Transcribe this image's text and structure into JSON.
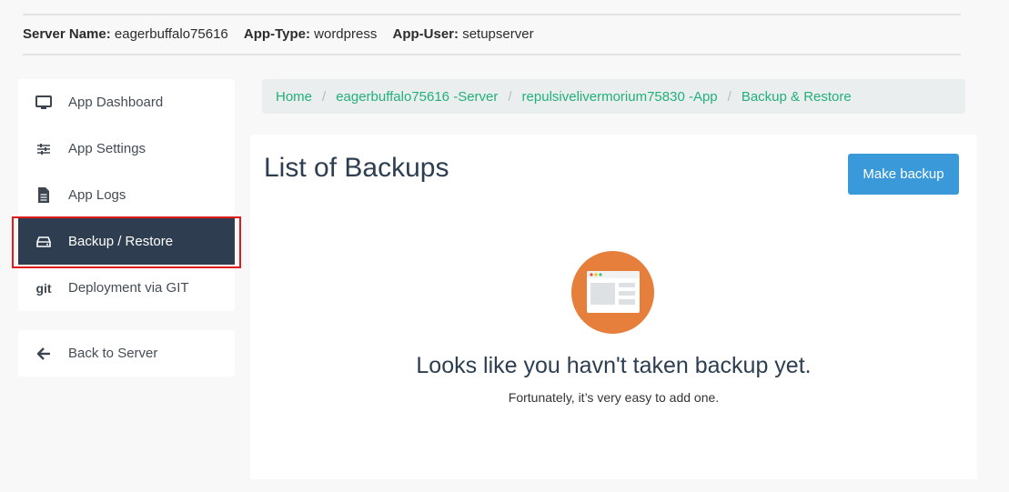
{
  "header": {
    "server_name_label": "Server Name:",
    "server_name_value": "eagerbuffalo75616",
    "app_type_label": "App-Type:",
    "app_type_value": "wordpress",
    "app_user_label": "App-User:",
    "app_user_value": "setupserver"
  },
  "sidebar": {
    "items": [
      {
        "label": "App Dashboard",
        "icon": "monitor-icon"
      },
      {
        "label": "App Settings",
        "icon": "sliders-icon"
      },
      {
        "label": "App Logs",
        "icon": "file-icon"
      },
      {
        "label": "Backup / Restore",
        "icon": "hard-drive-icon",
        "active": true
      },
      {
        "label": "Deployment via GIT",
        "icon": "git-icon",
        "icon_text": "git"
      }
    ],
    "back": {
      "label": "Back to Server",
      "icon": "arrow-left-icon"
    }
  },
  "breadcrumb": {
    "items": [
      "Home",
      "eagerbuffalo75616 -Server",
      "repulsivelivermorium75830 -App",
      "Backup & Restore"
    ],
    "separator": "/"
  },
  "main": {
    "title": "List of Backups",
    "make_backup_label": "Make backup",
    "empty_title": "Looks like you havn't taken backup yet.",
    "empty_subtitle": "Fortunately, it’s very easy to add one.",
    "illustration_icon": "browser-window-icon"
  },
  "colors": {
    "accent_green": "#22b07a",
    "button_blue": "#3a9ad9",
    "active_bg": "#2e3e50",
    "highlight_red": "#e01b1b",
    "illustration_orange": "#e67e3c"
  }
}
